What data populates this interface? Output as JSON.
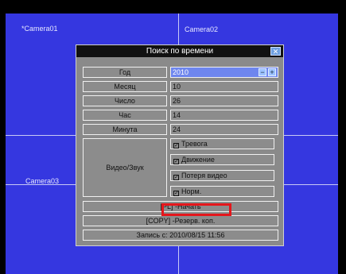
{
  "cameras": [
    "*Camera01",
    "Camera02",
    "Camera03"
  ],
  "dialog": {
    "title": "Поиск по времени",
    "close_glyph": "✕",
    "fields": [
      {
        "label": "Год",
        "value": "2010"
      },
      {
        "label": "Месяц",
        "value": "10"
      },
      {
        "label": "Число",
        "value": "26"
      },
      {
        "label": "Час",
        "value": "14"
      },
      {
        "label": "Минута",
        "value": "24"
      }
    ],
    "spin_minus": "−",
    "spin_plus": "+",
    "video_audio_label": "Видео/Звук",
    "checks": [
      "Тревога",
      "Движение",
      "Потеря видео",
      "Норм."
    ],
    "check_mark": "✓",
    "start_line": "[PL] -Начать",
    "copy_line": "[COPY] -Резерв. коп.",
    "record_line": "Запись с: 2010/08/15 11:56"
  },
  "colors": {
    "screen": "#3537e0",
    "highlight": "#e5161b",
    "selected": "#6e86ee"
  }
}
